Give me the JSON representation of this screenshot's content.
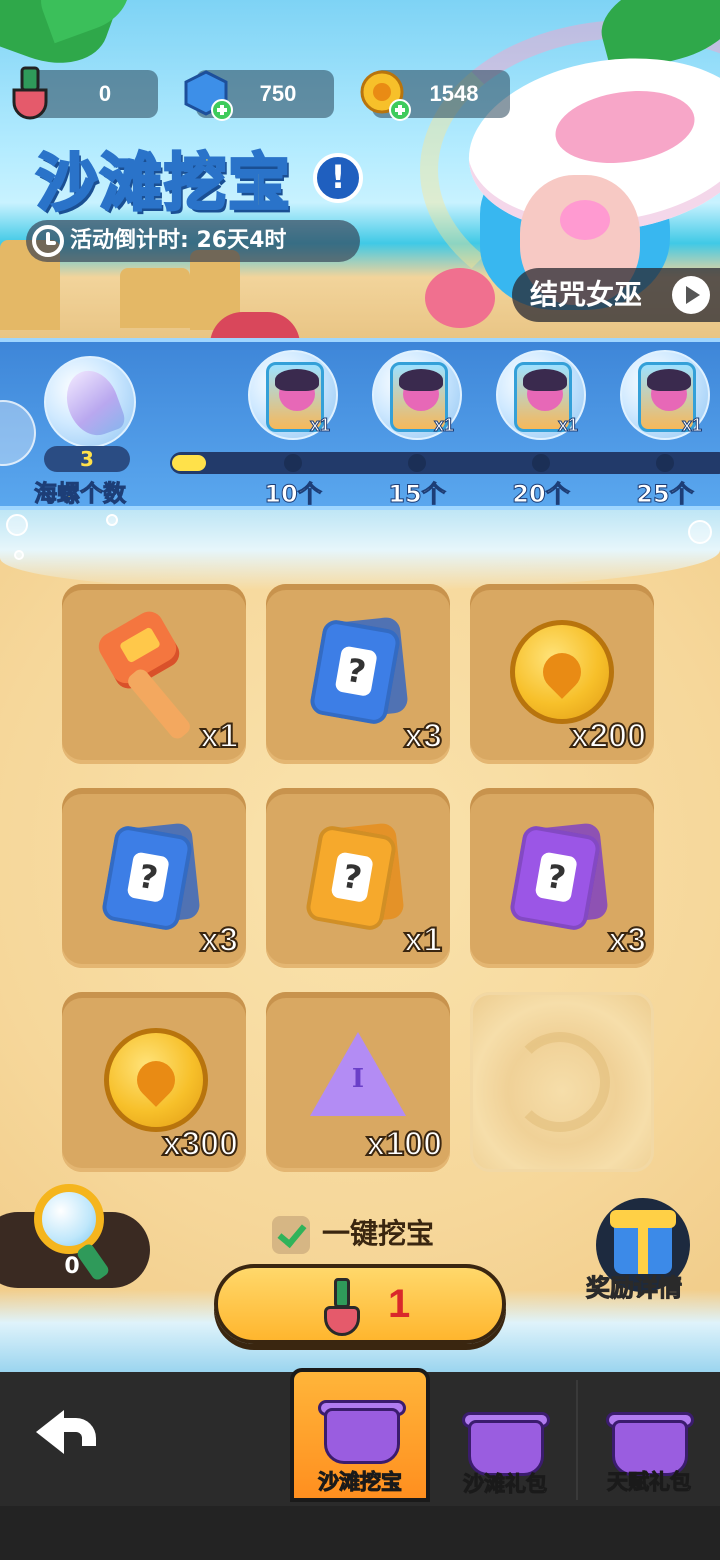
{
  "resources": {
    "shovels": "0",
    "gems": "750",
    "coins": "1548"
  },
  "event": {
    "title": "沙滩挖宝",
    "countdown": "活动倒计时: 26天4时",
    "hero_name": "结咒女巫"
  },
  "progress": {
    "shell_count": "3",
    "shell_label": "海螺个数",
    "fill_fraction": 0.06,
    "milestones": [
      {
        "qty": "x1",
        "label": "10个"
      },
      {
        "qty": "x1",
        "label": "15个"
      },
      {
        "qty": "x1",
        "label": "20个"
      },
      {
        "qty": "x1",
        "label": "25个"
      }
    ]
  },
  "grid": [
    {
      "item": "key-icon",
      "qty": "x1"
    },
    {
      "item": "blue-card-icon",
      "qty": "x3"
    },
    {
      "item": "gold-coin-icon",
      "qty": "x200"
    },
    {
      "item": "blue-card-icon",
      "qty": "x3"
    },
    {
      "item": "orange-card-icon",
      "qty": "x1"
    },
    {
      "item": "purple-card-icon",
      "qty": "x3"
    },
    {
      "item": "gold-coin-icon",
      "qty": "x300"
    },
    {
      "item": "gem-icon",
      "qty": "x100"
    },
    {
      "item": "sand-swirl",
      "qty": ""
    }
  ],
  "controls": {
    "magnifier_count": "0",
    "one_key_dig": "一键挖宝",
    "dig_cost": "1",
    "reward_details": "奖励详情"
  },
  "nav": {
    "tabs": [
      "沙滩挖宝",
      "沙滩礼包",
      "天赋礼包"
    ]
  },
  "colors": {
    "accent_yellow": "#ffe14a",
    "strip_blue": "#4f9ae6",
    "cell_brown": "#d9a862",
    "button_orange": "#ffb62e"
  }
}
